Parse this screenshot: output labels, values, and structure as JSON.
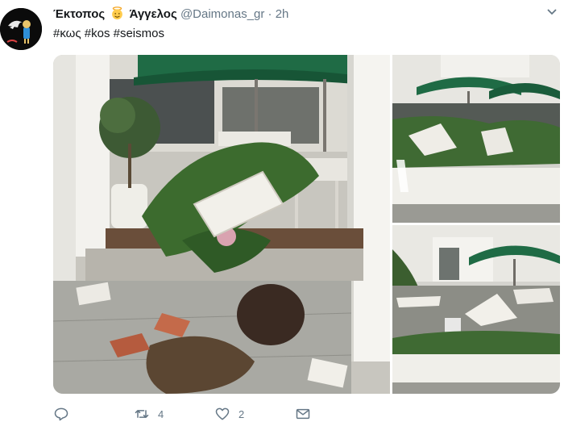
{
  "tweet": {
    "author": {
      "display_name_part1": "Έκτοπος",
      "display_name_part2": "Άγγελος",
      "handle": "@Daimonas_gr",
      "time": "2h",
      "separator": "·"
    },
    "text": "#κως #kos #seismos",
    "icons": {
      "avatar": "devil-character-avatar",
      "angel_emoji": "angel-icon",
      "menu": "chevron-down-icon"
    },
    "actions": {
      "reply_count": "",
      "retweet_count": "4",
      "like_count": "2",
      "dm_count": ""
    },
    "colors": {
      "text": "#14171a",
      "secondary": "#657786",
      "umbrella_green": "#1f6b45"
    }
  }
}
